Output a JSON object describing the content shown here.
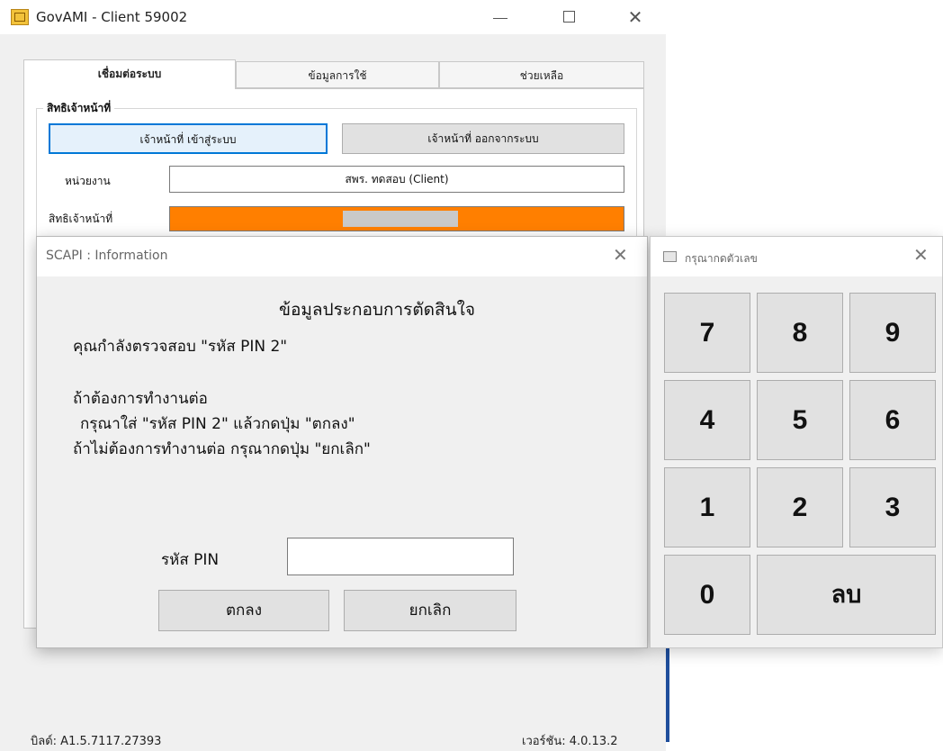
{
  "main_window": {
    "title": "GovAMI - Client 59002",
    "tabs": [
      {
        "label": "เชื่อมต่อระบบ"
      },
      {
        "label": "ข้อมูลการใช้"
      },
      {
        "label": "ช่วยเหลือ"
      }
    ],
    "group_title": "สิทธิเจ้าหน้าที่",
    "login_button": "เจ้าหน้าที่ เข้าสู่ระบบ",
    "logout_button": "เจ้าหน้าที่ ออกจากระบบ",
    "agency_label": "หน่วยงาน",
    "agency_value": "สพร. ทดสอบ (Client)",
    "rights_label": "สิทธิเจ้าหน้าที่",
    "build": "บิลด์: A1.5.7117.27393",
    "version": "เวอร์ชัน: 4.0.13.2",
    "colors": {
      "rights_bar": "#ff7f00",
      "focus": "#0078d7"
    }
  },
  "dialog": {
    "title": "SCAPI : Information",
    "heading": "ข้อมูลประกอบการตัดสินใจ",
    "lines": [
      "คุณกำลังตรวจสอบ \"รหัส PIN 2\"",
      "ถ้าต้องการทำงานต่อ",
      "กรุณาใส่ \"รหัส PIN 2\" แล้วกดปุ่ม \"ตกลง\"",
      "ถ้าไม่ต้องการทำงานต่อ กรุณากดปุ่ม \"ยกเลิก\""
    ],
    "pin_label": "รหัส PIN",
    "pin_value": "",
    "ok_button": "ตกลง",
    "cancel_button": "ยกเลิก"
  },
  "keypad": {
    "title": "กรุณากดตัวเลข",
    "keys": [
      "7",
      "8",
      "9",
      "4",
      "5",
      "6",
      "1",
      "2",
      "3",
      "0"
    ],
    "delete_label": "ลบ"
  }
}
